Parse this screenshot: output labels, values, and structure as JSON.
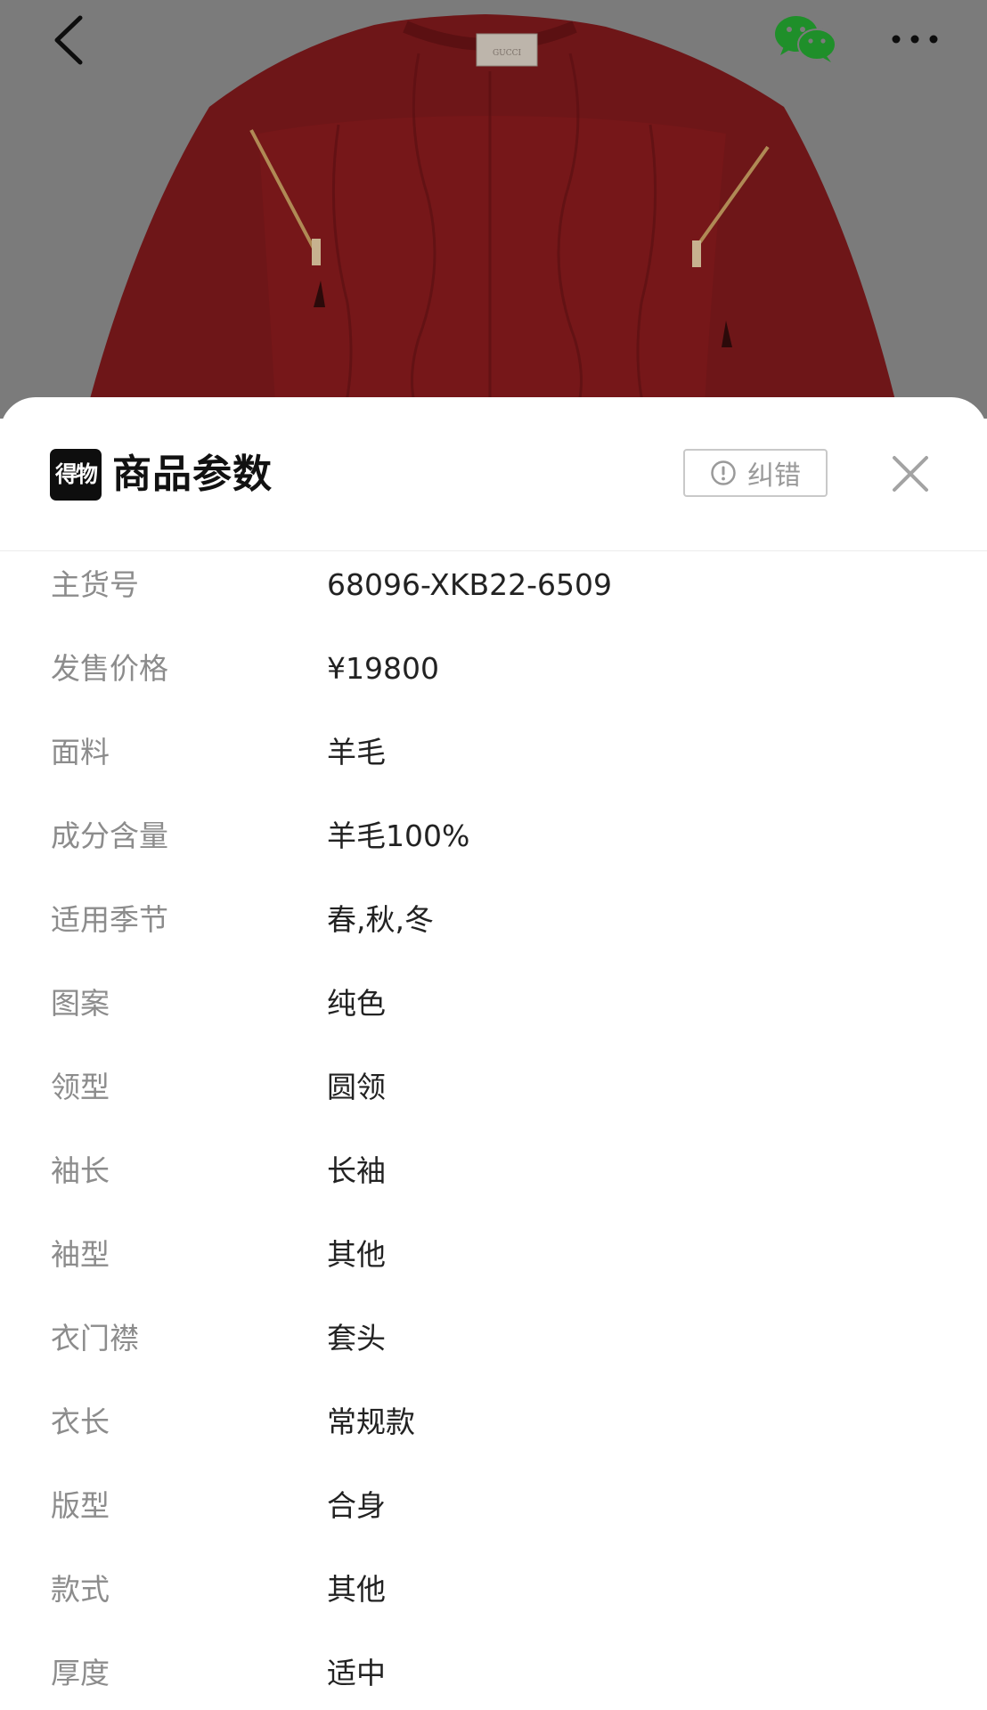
{
  "nav": {
    "back_icon": "chevron-left-icon",
    "share_icon": "wechat-icon",
    "more_icon": "more-dots-icon"
  },
  "hero": {
    "label_text": "GUCCI",
    "sweater_color": "#a11a1c",
    "overlay_color": "#7b7b7b"
  },
  "sheet": {
    "logo_text": "得物",
    "title": "商品参数",
    "report_label": "纠错",
    "report_icon": "alert-circle-icon",
    "close_icon": "close-icon"
  },
  "params": [
    {
      "label": "主货号",
      "value": "68096-XKB22-6509"
    },
    {
      "label": "发售价格",
      "value": "¥19800"
    },
    {
      "label": "面料",
      "value": "羊毛"
    },
    {
      "label": "成分含量",
      "value": "羊毛100%"
    },
    {
      "label": "适用季节",
      "value": "春,秋,冬"
    },
    {
      "label": "图案",
      "value": "纯色"
    },
    {
      "label": "领型",
      "value": "圆领"
    },
    {
      "label": "袖长",
      "value": "长袖"
    },
    {
      "label": "袖型",
      "value": "其他"
    },
    {
      "label": "衣门襟",
      "value": "套头"
    },
    {
      "label": "衣长",
      "value": "常规款"
    },
    {
      "label": "版型",
      "value": "合身"
    },
    {
      "label": "款式",
      "value": "其他"
    },
    {
      "label": "厚度",
      "value": "适中"
    }
  ]
}
